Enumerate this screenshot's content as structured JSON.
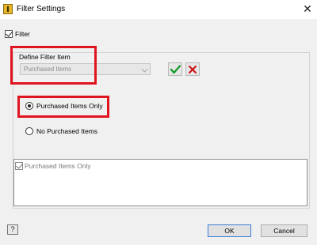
{
  "window": {
    "title": "Filter Settings",
    "close_glyph": "✕"
  },
  "filter": {
    "label": "Filter",
    "checked": true
  },
  "define_filter": {
    "label": "Define Filter Item",
    "dropdown_value": "Purchased Items",
    "apply_icon": "checkmark-icon",
    "remove_icon": "red-x-icon"
  },
  "options": {
    "option1_label": "Purchased Items Only",
    "option1_selected": true,
    "option2_label": "No Purchased Items",
    "option2_selected": false
  },
  "list": {
    "items": [
      {
        "label": "Purchased Items Only",
        "checked": true
      }
    ]
  },
  "buttons": {
    "help_glyph": "?",
    "ok_label": "OK",
    "cancel_label": "Cancel"
  },
  "colors": {
    "highlight_red": "#e0141e",
    "check_green": "#1a9b2a",
    "x_red": "#d01010",
    "ok_border_blue": "#3b7bd8"
  }
}
